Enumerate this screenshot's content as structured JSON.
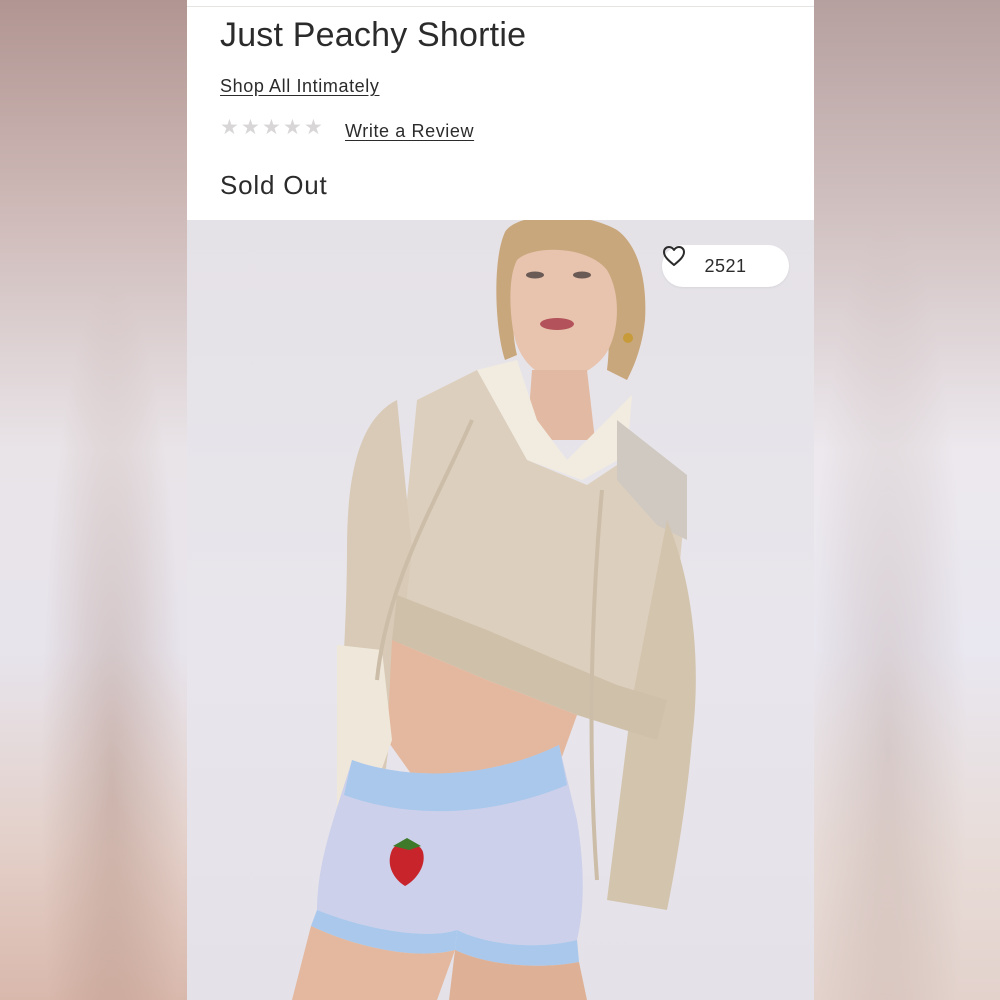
{
  "product": {
    "title": "Just Peachy Shortie",
    "shop_link": "Shop All Intimately",
    "rating_stars": 5,
    "rating_value": 0,
    "review_link": "Write a Review",
    "status": "Sold Out"
  },
  "favorites": {
    "count": "2521",
    "icon": "heart-outline-icon"
  },
  "colors": {
    "text": "#2b2b2b",
    "star_empty": "#d8d6d6",
    "card_bg": "#ffffff"
  }
}
